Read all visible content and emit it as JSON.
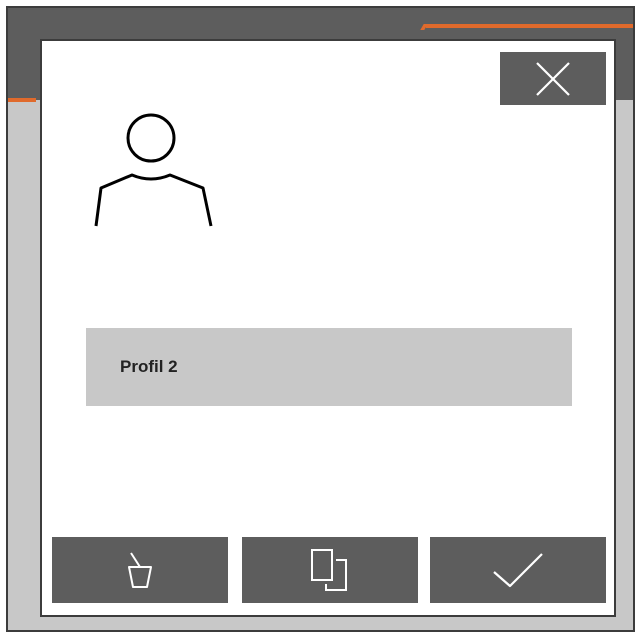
{
  "dialog": {
    "profile_name": "Profil 2"
  },
  "icons": {
    "close": "close-icon",
    "user": "user-icon",
    "delete": "trash-icon",
    "copy": "copy-icon",
    "confirm": "checkmark-icon"
  },
  "colors": {
    "frame_background": "#c8c8c8",
    "button_background": "#5d5d5d",
    "accent": "#e06a2c",
    "dialog_background": "#ffffff",
    "field_background": "#c8c8c8"
  }
}
